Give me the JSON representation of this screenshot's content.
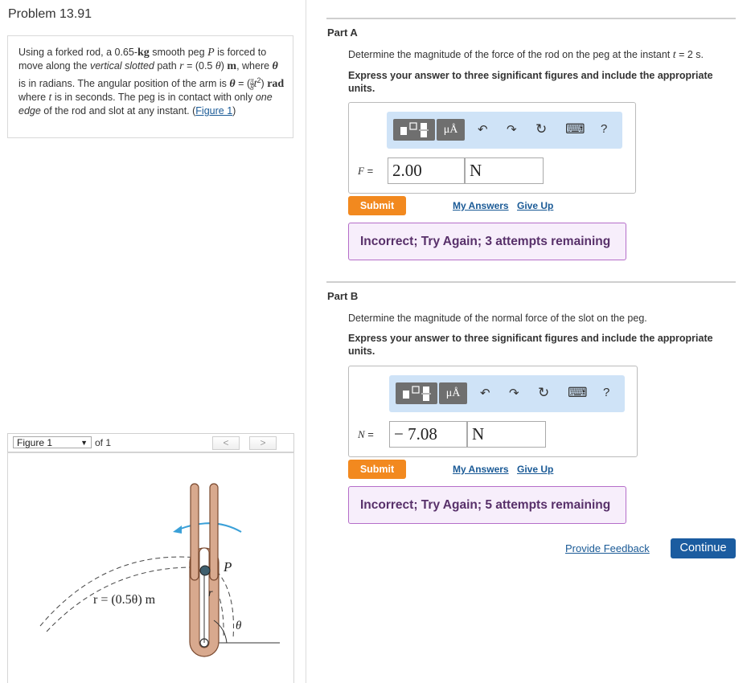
{
  "problem": {
    "title": "Problem 13.91",
    "text_parts": {
      "p1": "Using a forked rod, a 0.65-",
      "kg": "kg",
      "p2": " smooth peg ",
      "P": "P",
      "p3": " is forced to move along the ",
      "vsp": "vertical slotted",
      "p4": " path ",
      "r_eq": "r",
      "p5": " = (0.5 ",
      "theta": "θ",
      "p6": ") ",
      "m": "m",
      "p7": ", where ",
      "theta2": "θ",
      "p8": " is in radians. The angular position of the arm is ",
      "theta3": "θ",
      "p9": " = (",
      "frac_num": "π",
      "frac_den": "8",
      "t2": "t",
      "sq": "2",
      "p10": ") ",
      "rad": "rad",
      "p11": " where ",
      "t3": "t",
      "p12": " is in seconds. The peg is in contact with only ",
      "one_edge": "one edge",
      "p13": " of the rod and slot at any instant. (",
      "fig_link": "Figure 1",
      "p14": ")"
    }
  },
  "figure_nav": {
    "selected": "Figure 1",
    "of_label": "of 1",
    "prev_glyph": "<",
    "next_glyph": ">"
  },
  "figure": {
    "label_P": "P",
    "label_r": "r",
    "label_eq": "r = (0.5θ) m",
    "label_theta": "θ"
  },
  "toolbar": {
    "mu_label": "μÅ",
    "undo_glyph": "↶",
    "redo_glyph": "↷",
    "reset_glyph": "↻",
    "keyboard_glyph": "⌨",
    "help_glyph": "?"
  },
  "part_a": {
    "title": "Part A",
    "question_pre": "Determine the magnitude of the force of the rod on the peg at the instant ",
    "question_t": "t",
    "question_post": " = 2 s.",
    "instruction": "Express your answer to three significant figures and include the appropriate units.",
    "var": "F",
    "eq": " =",
    "value": "2.00",
    "unit": "N",
    "submit": "Submit",
    "my_answers": "My Answers",
    "give_up": "Give Up",
    "feedback": "Incorrect; Try Again; 3 attempts remaining"
  },
  "part_b": {
    "title": "Part B",
    "question": "Determine the magnitude of the normal force of the slot on the peg.",
    "instruction": "Express your answer to three significant figures and include the appropriate units.",
    "var": "N",
    "eq": " =",
    "value": "− 7.08",
    "unit": "N",
    "submit": "Submit",
    "my_answers": "My Answers",
    "give_up": "Give Up",
    "feedback": "Incorrect; Try Again; 5 attempts remaining"
  },
  "footer": {
    "provide_feedback": "Provide Feedback",
    "continue": "Continue"
  },
  "colors": {
    "accent_orange": "#f2891f",
    "link_blue": "#1a5a96",
    "continue_blue": "#1b5ca0",
    "toolbar_blue": "#cfe3f7",
    "feedback_border": "#b56ec9",
    "feedback_bg": "#f7eefb",
    "rod_color": "#d8a98e",
    "arrow_color": "#3aa0d8"
  }
}
